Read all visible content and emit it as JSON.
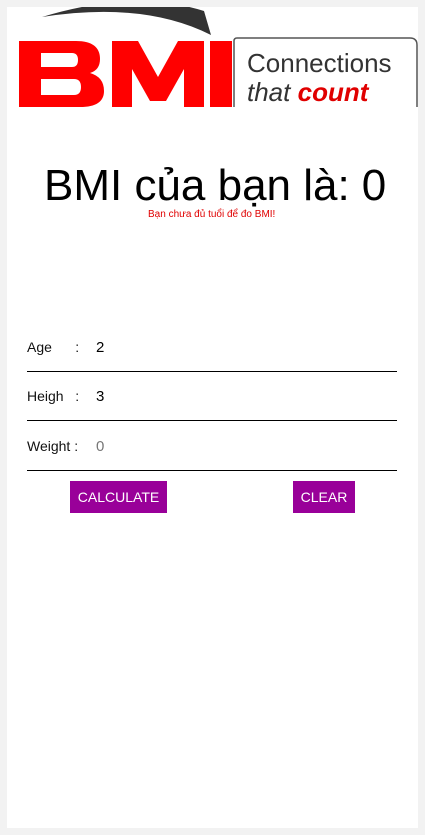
{
  "brand": {
    "logo_text": "BMI",
    "tagline_line1": "Connections",
    "tagline_line2_prefix": "that",
    "tagline_line2_accent": "count",
    "colors": {
      "brand_red": "#ff0000",
      "accent_red": "#e00000",
      "swoosh": "#333333"
    }
  },
  "result": {
    "label": "BMI của bạn là:",
    "value": "0",
    "note": "Bạn chưa đủ tuổi để đo BMI!"
  },
  "form": {
    "age": {
      "label": "Age      :",
      "value": "2",
      "placeholder": ""
    },
    "height": {
      "label": "Heigh   :",
      "value": "3",
      "placeholder": ""
    },
    "weight": {
      "label": "Weight :",
      "value": "",
      "placeholder": "0"
    }
  },
  "buttons": {
    "calculate_label": "CALCULATE",
    "clear_label": "CLEAR",
    "color": "#990099"
  }
}
